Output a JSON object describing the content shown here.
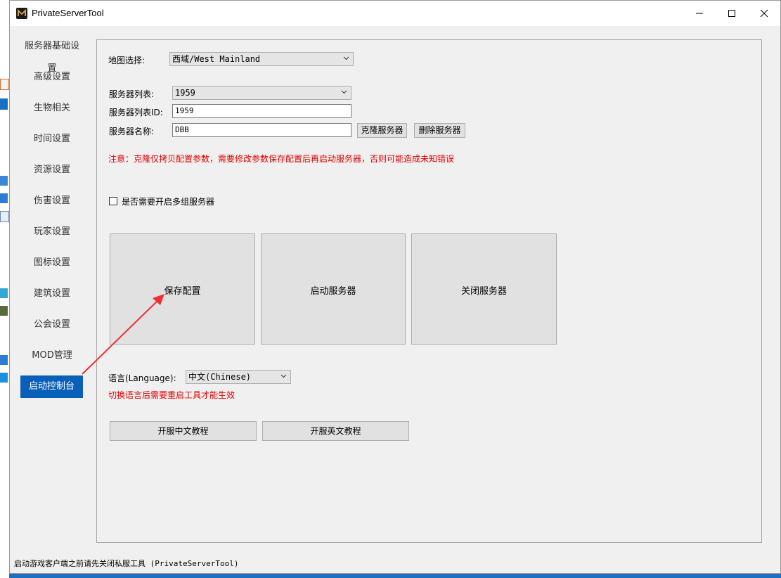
{
  "window": {
    "title": "PrivateServerTool",
    "minimize_label": "minimize",
    "maximize_label": "maximize",
    "close_label": "close"
  },
  "sidebar": {
    "items": [
      {
        "label": "服务器基础设置"
      },
      {
        "label": "高级设置"
      },
      {
        "label": "生物相关"
      },
      {
        "label": "时间设置"
      },
      {
        "label": "资源设置"
      },
      {
        "label": "伤害设置"
      },
      {
        "label": "玩家设置"
      },
      {
        "label": "图标设置"
      },
      {
        "label": "建筑设置"
      },
      {
        "label": "公会设置"
      },
      {
        "label": "MOD管理"
      },
      {
        "label": "启动控制台"
      }
    ],
    "active_index": 11
  },
  "map": {
    "label": "地图选择:",
    "value": "西域/West Mainland"
  },
  "server_list": {
    "label": "服务器列表:",
    "value": "1959"
  },
  "server_list_id": {
    "label": "服务器列表ID:",
    "value": "1959"
  },
  "server_name": {
    "label": "服务器名称:",
    "value": "DBB"
  },
  "buttons": {
    "clone_server": "克隆服务器",
    "delete_server": "删除服务器",
    "save_config": "保存配置",
    "start_server": "启动服务器",
    "stop_server": "关闭服务器",
    "tutorial_cn": "开服中文教程",
    "tutorial_en": "开服英文教程"
  },
  "notice": "注意：克隆仅拷贝配置参数，需要修改参数保存配置后再启动服务器，否则可能造成未知错误",
  "multi_server": {
    "label": "是否需要开启多组服务器",
    "checked": false
  },
  "language": {
    "label": "语言(Language):",
    "value": "中文(Chinese)",
    "hint": "切换语言后需要重启工具才能生效"
  },
  "status_bar": "启动游戏客户端之前请先关闭私服工具 (PrivateServerTool)",
  "colors": {
    "accent": "#0a5fb8",
    "warning": "#e00000",
    "annotation_arrow": "#f03030"
  },
  "icons": {
    "app": "m-logo-icon",
    "dropdown": "chevron-down-icon"
  }
}
